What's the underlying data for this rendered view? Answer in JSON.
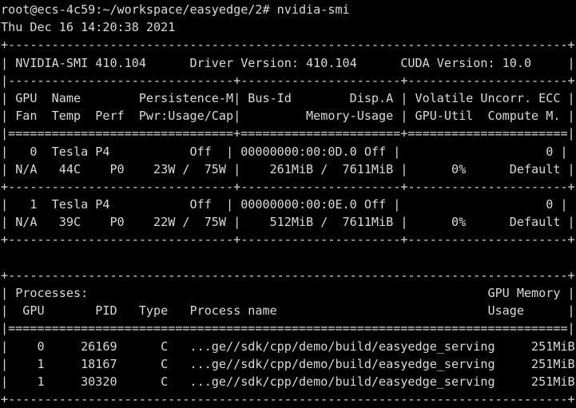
{
  "terminal": {
    "kind": "shell-terminal",
    "background_color": "#000000",
    "foreground_color": "#d9d9d9",
    "columns": 79,
    "rows": 22,
    "prompt": {
      "user": "root",
      "host": "ecs-4c59",
      "path": "~/workspace/easyedge/2",
      "symbol": "#",
      "full": "root@ecs-4c59:~/workspace/easyedge/2#",
      "command": "nvidia-smi"
    },
    "lines": [
      "root@ecs-4c59:~/workspace/easyedge/2# nvidia-smi",
      "Thu Dec 16 14:20:38 2021",
      "+-----------------------------------------------------------------------------+",
      "| NVIDIA-SMI 410.104      Driver Version: 410.104      CUDA Version: 10.0     |",
      "|-------------------------------+----------------------+----------------------+",
      "| GPU  Name        Persistence-M| Bus-Id        Disp.A | Volatile Uncorr. ECC |",
      "| Fan  Temp  Perf  Pwr:Usage/Cap|         Memory-Usage | GPU-Util  Compute M. |",
      "|===============================+======================+======================|",
      "|   0  Tesla P4           Off  | 00000000:00:0D.0 Off |                    0 |",
      "| N/A   44C    P0    23W /  75W |    261MiB /  7611MiB |      0%      Default |",
      "+-------------------------------+----------------------+----------------------+",
      "|   1  Tesla P4           Off  | 00000000:00:0E.0 Off |                    0 |",
      "| N/A   39C    P0    22W /  75W |    512MiB /  7611MiB |      0%      Default |",
      "+-------------------------------+----------------------+----------------------+",
      "",
      "+-----------------------------------------------------------------------------+",
      "| Processes:                                                       GPU Memory |",
      "|  GPU       PID   Type   Process name                             Usage      |",
      "|=============================================================================|",
      "|    0     26169      C   ...ge//sdk/cpp/demo/build/easyedge_serving     251MiB |",
      "|    1     18167      C   ...ge//sdk/cpp/demo/build/easyedge_serving     251MiB |",
      "|    1     30320      C   ...ge//sdk/cpp/demo/build/easyedge_serving     251MiB |",
      "+-----------------------------------------------------------------------------+"
    ],
    "timestamp": "Thu Dec 16 14:20:38 2021",
    "smi_header": {
      "smi_label": "NVIDIA-SMI",
      "smi_version": "410.104",
      "driver_label": "Driver Version:",
      "driver_version": "410.104",
      "cuda_label": "CUDA Version:",
      "cuda_version": "10.0"
    },
    "gpu_table": {
      "headers_row1": [
        "GPU",
        "Name",
        "Persistence-M",
        "Bus-Id",
        "Disp.A",
        "Volatile Uncorr. ECC"
      ],
      "headers_row2": [
        "Fan",
        "Temp",
        "Perf",
        "Pwr:Usage/Cap",
        "Memory-Usage",
        "GPU-Util",
        "Compute M."
      ],
      "gpus": [
        {
          "index": "0",
          "name": "Tesla P4",
          "persistence_mode": "Off",
          "bus_id": "00000000:00:0D.0",
          "disp_a": "Off",
          "ecc_errors": "0",
          "fan": "N/A",
          "temp": "44C",
          "perf": "P0",
          "power_usage": "23W",
          "power_cap": "75W",
          "memory_used": "261MiB",
          "memory_total": "7611MiB",
          "gpu_util": "0%",
          "compute_mode": "Default"
        },
        {
          "index": "1",
          "name": "Tesla P4",
          "persistence_mode": "Off",
          "bus_id": "00000000:00:0E.0",
          "disp_a": "Off",
          "ecc_errors": "0",
          "fan": "N/A",
          "temp": "39C",
          "perf": "P0",
          "power_usage": "22W",
          "power_cap": "75W",
          "memory_used": "512MiB",
          "memory_total": "7611MiB",
          "gpu_util": "0%",
          "compute_mode": "Default"
        }
      ]
    },
    "processes_table": {
      "title": "Processes:",
      "memory_header_row1": "GPU Memory",
      "memory_header_row2": "Usage",
      "headers": [
        "GPU",
        "PID",
        "Type",
        "Process name",
        "Usage"
      ],
      "rows": [
        {
          "gpu": "0",
          "pid": "26169",
          "type": "C",
          "process_name": "...ge//sdk/cpp/demo/build/easyedge_serving",
          "usage": "251MiB"
        },
        {
          "gpu": "1",
          "pid": "18167",
          "type": "C",
          "process_name": "...ge//sdk/cpp/demo/build/easyedge_serving",
          "usage": "251MiB"
        },
        {
          "gpu": "1",
          "pid": "30320",
          "type": "C",
          "process_name": "...ge//sdk/cpp/demo/build/easyedge_serving",
          "usage": "251MiB"
        }
      ]
    }
  }
}
